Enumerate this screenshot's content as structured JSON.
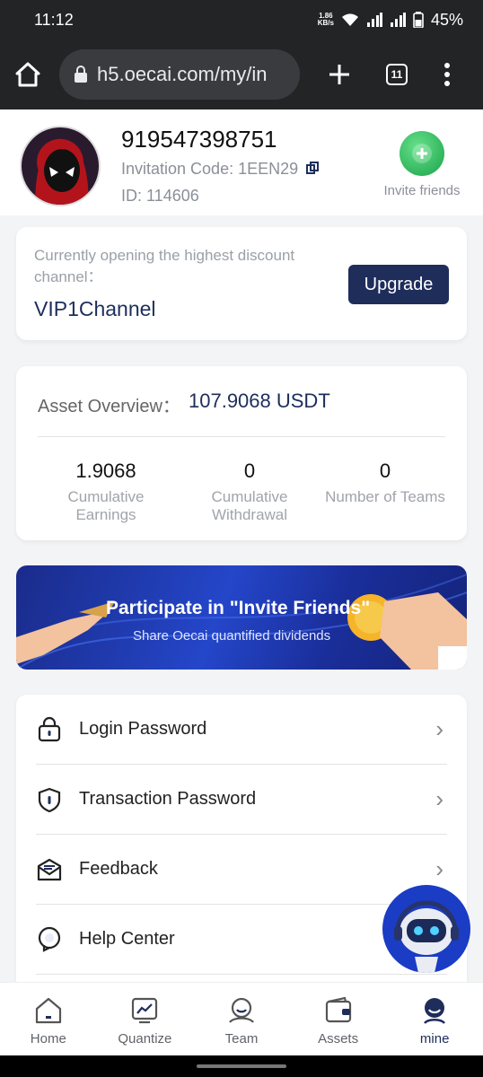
{
  "status_bar": {
    "time": "11:12",
    "speed_value": "1.86",
    "speed_unit": "KB/s",
    "battery": "45%"
  },
  "browser": {
    "url": "h5.oecai.com/my/in",
    "tab_count": "11"
  },
  "profile": {
    "phone": "919547398751",
    "invitation_code_label": "Invitation Code: 1EEN29",
    "user_id": "ID: 114606",
    "invite_label": "Invite friends"
  },
  "vip": {
    "description": "Currently opening the highest discount channel：",
    "channel": "VIP1Channel",
    "upgrade_label": "Upgrade"
  },
  "assets": {
    "title": "Asset Overview：",
    "value": "107.9068 USDT",
    "stats": [
      {
        "value": "1.9068",
        "label": "Cumulative Earnings"
      },
      {
        "value": "0",
        "label": "Cumulative Withdrawal"
      },
      {
        "value": "0",
        "label": "Number of Teams"
      }
    ]
  },
  "banner": {
    "title": "Participate in \"Invite Friends\"",
    "subtitle": "Share Oecai quantified dividends"
  },
  "menu": {
    "items": [
      {
        "label": "Login Password",
        "icon": "lock-icon"
      },
      {
        "label": "Transaction Password",
        "icon": "shield-icon"
      },
      {
        "label": "Feedback",
        "icon": "feedback-icon"
      },
      {
        "label": "Help Center",
        "icon": "help-icon"
      }
    ]
  },
  "bottom_nav": {
    "items": [
      {
        "label": "Home",
        "icon": "home-icon"
      },
      {
        "label": "Quantize",
        "icon": "chart-icon"
      },
      {
        "label": "Team",
        "icon": "team-icon"
      },
      {
        "label": "Assets",
        "icon": "wallet-icon"
      },
      {
        "label": "mine",
        "icon": "user-icon",
        "active": true
      }
    ]
  },
  "colors": {
    "accent": "#1e2d5a",
    "invite_green": "#1aa34a",
    "banner_blue": "#2446c9"
  }
}
